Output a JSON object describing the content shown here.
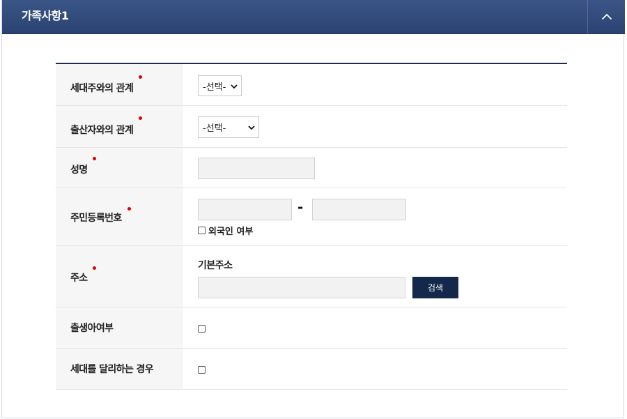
{
  "panel": {
    "title": "가족사항1"
  },
  "form": {
    "relation_head": {
      "label": "세대주와의 관계",
      "select_value": "-선택-"
    },
    "relation_birth": {
      "label": "출산자와의 관계",
      "select_value": "-선택-"
    },
    "name": {
      "label": "성명",
      "value": ""
    },
    "resident_number": {
      "label": "주민등록번호",
      "part1": "",
      "part2": "",
      "separator": "-",
      "foreigner_label": "외국인 여부"
    },
    "address": {
      "label": "주소",
      "sub_label": "기본주소",
      "value": "",
      "search_label": "검색"
    },
    "newborn": {
      "label": "출생아여부"
    },
    "separate_household": {
      "label": "세대를 달리하는 경우"
    }
  }
}
